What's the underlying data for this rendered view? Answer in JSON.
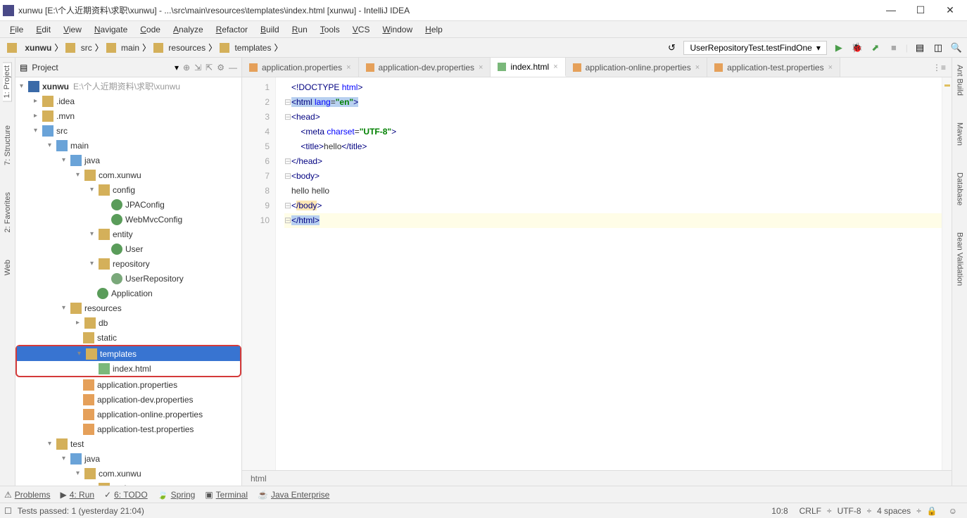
{
  "title": "xunwu [E:\\个人近期资料\\求职\\xunwu] - ...\\src\\main\\resources\\templates\\index.html [xunwu] - IntelliJ IDEA",
  "menu": [
    "File",
    "Edit",
    "View",
    "Navigate",
    "Code",
    "Analyze",
    "Refactor",
    "Build",
    "Run",
    "Tools",
    "VCS",
    "Window",
    "Help"
  ],
  "breadcrumbs": [
    "xunwu",
    "src",
    "main",
    "resources",
    "templates"
  ],
  "run_config": "UserRepositoryTest.testFindOne",
  "side": {
    "title": "Project"
  },
  "tree": {
    "root": "xunwu",
    "root_hint": "E:\\个人近期资料\\求职\\xunwu",
    "idea": ".idea",
    "mvn": ".mvn",
    "src": "src",
    "main": "main",
    "java": "java",
    "pkg": "com.xunwu",
    "config": "config",
    "jpa": "JPAConfig",
    "webmvc": "WebMvcConfig",
    "entity": "entity",
    "user": "User",
    "repo_pkg": "repository",
    "userrepo": "UserRepository",
    "application": "Application",
    "resources": "resources",
    "db": "db",
    "static": "static",
    "templates": "templates",
    "indexhtml": "index.html",
    "appprop": "application.properties",
    "appdev": "application-dev.properties",
    "apponline": "application-online.properties",
    "apptest": "application-test.properties",
    "test": "test",
    "java2": "java",
    "pkg2": "com.xunwu",
    "entity2": "entity"
  },
  "tabs": [
    {
      "label": "application.properties",
      "active": false,
      "ic": "prop"
    },
    {
      "label": "application-dev.properties",
      "active": false,
      "ic": "prop"
    },
    {
      "label": "index.html",
      "active": true,
      "ic": "html"
    },
    {
      "label": "application-online.properties",
      "active": false,
      "ic": "prop"
    },
    {
      "label": "application-test.properties",
      "active": false,
      "ic": "prop"
    }
  ],
  "code": {
    "l1_a": "<!DOCTYPE ",
    "l1_b": "html",
    "l1_c": ">",
    "l2_a": "<html ",
    "l2_b": "lang",
    "l2_c": "=",
    "l2_d": "\"en\"",
    "l2_e": ">",
    "l3": "<head>",
    "l4_a": "    <meta ",
    "l4_b": "charset",
    "l4_c": "=",
    "l4_d": "\"UTF-8\"",
    "l4_e": ">",
    "l5_a": "    <title>",
    "l5_b": "hello",
    "l5_c": "</title>",
    "l6": "</head>",
    "l7": "<body>",
    "l8": "hello hello",
    "l9_a": "<",
    "l9_b": "/body",
    "l9_c": ">",
    "l10": "</html>"
  },
  "gutter": [
    "1",
    "2",
    "3",
    "4",
    "5",
    "6",
    "7",
    "8",
    "9",
    "10"
  ],
  "breadcrumb_bottom": "html",
  "bottom_tabs": [
    "Problems",
    "4: Run",
    "6: TODO",
    "Spring",
    "Terminal",
    "Java Enterprise"
  ],
  "status": {
    "msg": "Tests passed: 1 (yesterday 21:04)",
    "pos": "10:8",
    "le": "CRLF",
    "enc": "UTF-8",
    "indent": "4 spaces"
  },
  "left_rail": [
    "1: Project",
    "7: Structure",
    "2: Favorites",
    "Web"
  ],
  "right_rail": [
    "Ant Build",
    "Maven",
    "Database",
    "Bean Validation"
  ]
}
